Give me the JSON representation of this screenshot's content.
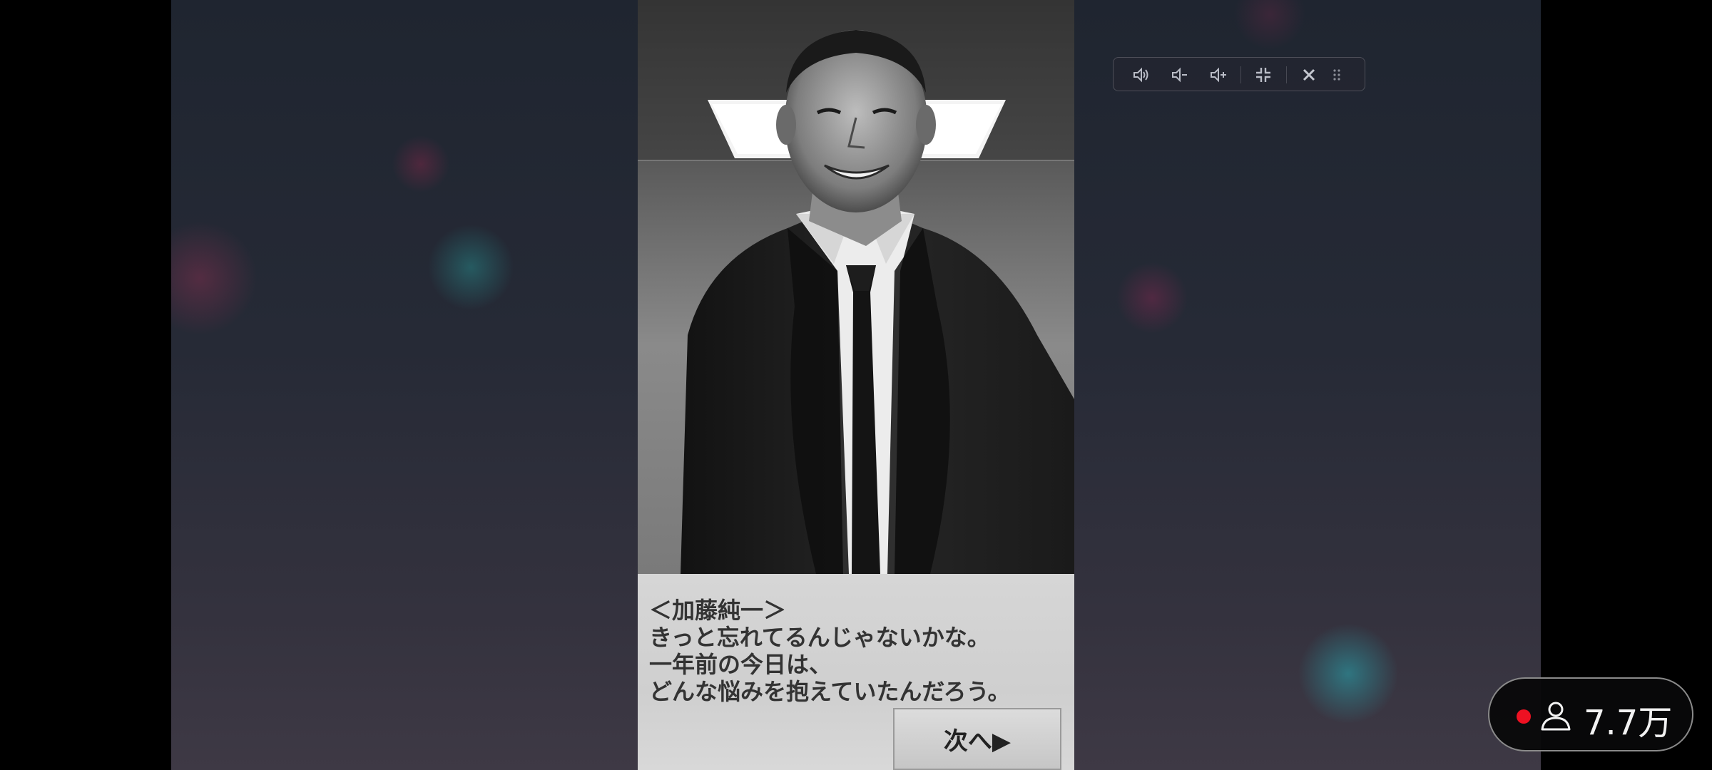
{
  "game": {
    "dialog": {
      "speaker": "＜加藤純一＞",
      "lines": [
        "きっと忘れてるんじゃないかな。",
        "一年前の今日は、",
        "どんな悩みを抱えていたんだろう。"
      ],
      "next_label": "次へ▶"
    }
  },
  "toolbar": {
    "icons": [
      "volume-icon",
      "volume-down-icon",
      "volume-up-icon",
      "exit-fullscreen-icon",
      "close-icon",
      "drag-handle-icon"
    ]
  },
  "live": {
    "viewer_count": "7.7万",
    "dot_color": "#ee1122"
  }
}
